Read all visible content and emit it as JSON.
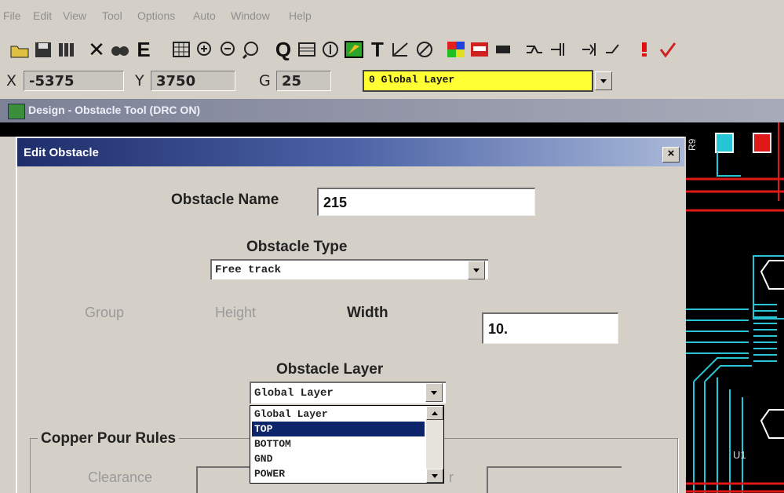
{
  "menu": [
    "File",
    "Edit",
    "View",
    "Tool",
    "Options",
    "Auto",
    "Window",
    "Help"
  ],
  "toolbar_icons": [
    "open-icon",
    "save-icon",
    "library-icon",
    "delete-icon",
    "find-icon",
    "edit-icon",
    "grid-icon",
    "zoom-in-icon",
    "zoom-out-icon",
    "zoom-window-icon",
    "query-icon",
    "ratsnest-icon",
    "measure-icon",
    "obstacle-icon",
    "text-icon",
    "dimension-icon",
    "no-connect-icon",
    "colors-icon",
    "drc-icon",
    "component-icon",
    "route-icon",
    "length-icon",
    "setup-icon",
    "rules-icon",
    "error-icon",
    "drc-check-icon"
  ],
  "toolbar_glyphs": {
    "text": "T",
    "edit": "E",
    "query": "Q",
    "delete": "✕"
  },
  "coords": {
    "x_label": "X",
    "x_value": "-5375",
    "y_label": "Y",
    "y_value": "3750",
    "g_label": "G",
    "g_value": "25",
    "layer_value": "0 Global Layer",
    "layer_color": "#ffff33"
  },
  "design_window": {
    "title": "Design - Obstacle Tool (DRC ON)"
  },
  "pcb_labels": {
    "r9": "R9",
    "u1": "U1"
  },
  "dialog": {
    "title": "Edit Obstacle",
    "close": "×",
    "obstacle_name_label": "Obstacle Name",
    "obstacle_name_value": "215",
    "obstacle_type_label": "Obstacle Type",
    "obstacle_type_value": "Free track",
    "group_label": "Group",
    "height_label": "Height",
    "width_label": "Width",
    "width_value": "10.",
    "obstacle_layer_label": "Obstacle Layer",
    "obstacle_layer_value": "Global Layer",
    "layer_options": [
      "Global Layer",
      "TOP",
      "BOTTOM",
      "GND",
      "POWER"
    ],
    "selected_option": "TOP",
    "copper_pour_label": "Copper Pour Rules",
    "clearance_label": "Clearance",
    "partial_label": "r"
  },
  "colors": {
    "selection": "#0b246a",
    "title_dark": "#1f2d6b",
    "pcb_cyan": "#26c6d6",
    "pcb_red": "#e01818"
  }
}
